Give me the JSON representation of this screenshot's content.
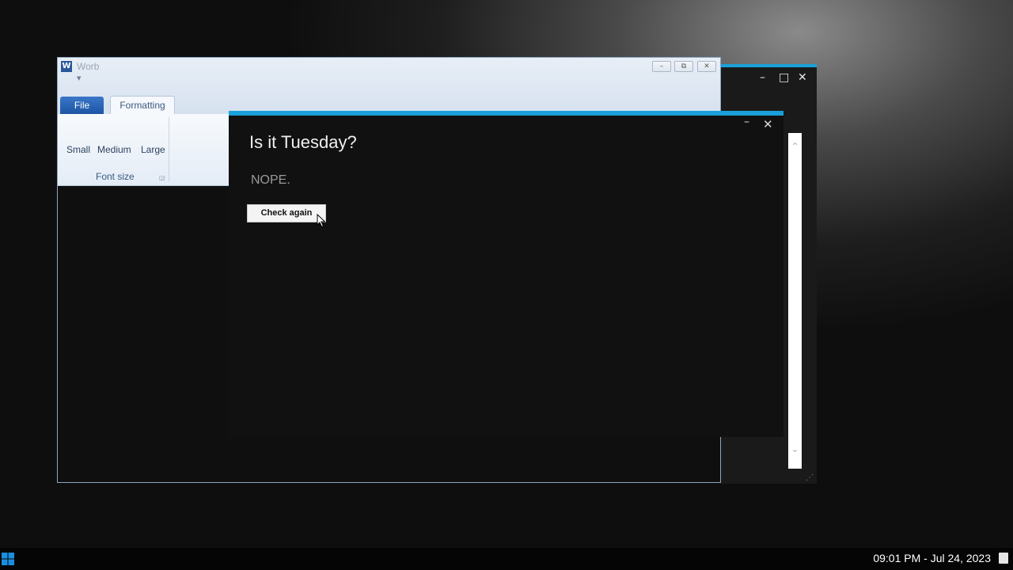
{
  "word": {
    "title": "Worb",
    "logo_letter": "W",
    "title_buttons": {
      "minimize": "–",
      "restore": "⧉",
      "close": "✕"
    },
    "tabs": [
      {
        "label": "File"
      },
      {
        "label": "Formatting"
      }
    ],
    "ribbon": {
      "font_size_buttons": [
        "Small",
        "Medium",
        "Large"
      ],
      "group_label": "Font size"
    }
  },
  "dialog": {
    "heading": "Is it Tuesday?",
    "answer": "NOPE.",
    "check_again_label": "Check again",
    "minimize_glyph": "–",
    "close_glyph": "✕"
  },
  "back_window": {
    "minimize_glyph": "–",
    "maximize_glyph": "□",
    "close_glyph": "✕",
    "scroll_up": "⌃",
    "scroll_down": "⌄"
  },
  "taskbar": {
    "clock": "09:01 PM - Jul 24, 2023",
    "start_icon": "windows-logo-icon",
    "notification_icon": "notification-icon"
  },
  "colors": {
    "accent": "#1aa0d8",
    "start_icon": "#1a8fe0",
    "file_tab": "#2b62b0"
  }
}
